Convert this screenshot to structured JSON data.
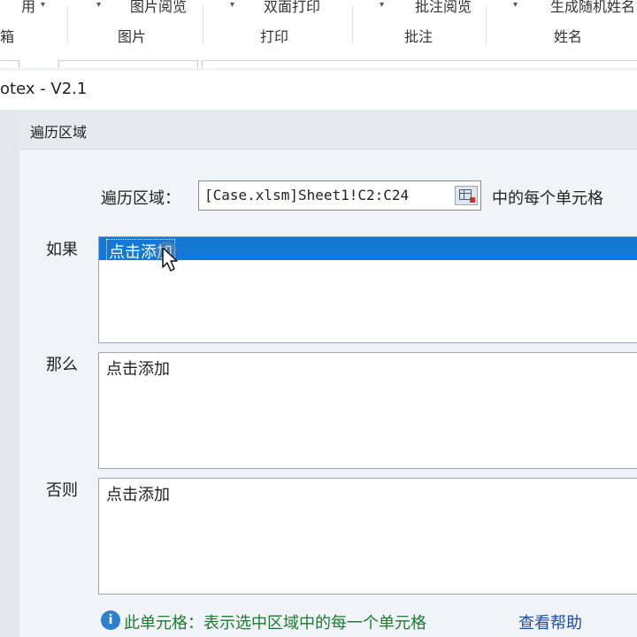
{
  "ribbon": {
    "groups": [
      {
        "button": "用",
        "label": "箱"
      },
      {
        "button": "图片阅览",
        "label": "图片"
      },
      {
        "button": "双面打印",
        "label": "打印"
      },
      {
        "button": "批注阅览",
        "label": "批注"
      },
      {
        "button": "生成随机姓名",
        "label": "姓名"
      }
    ]
  },
  "window": {
    "title": "otex - V2.1"
  },
  "section": {
    "title": "遍历区域"
  },
  "range": {
    "label": "遍历区域：",
    "value": "[Case.xlsm]Sheet1!C2:C24",
    "suffix": "中的每个单元格",
    "picker_icon": "range-select-icon"
  },
  "conditions": [
    {
      "label": "如果",
      "item": "点击添加",
      "selected": true
    },
    {
      "label": "那么",
      "item": "点击添加",
      "selected": false
    },
    {
      "label": "否则",
      "item": "点击添加",
      "selected": false
    }
  ],
  "footer": {
    "info_icon": "i",
    "text": "此单元格：表示选中区域中的每一个单元格",
    "help": "查看帮助"
  },
  "colors": {
    "selection": "#1378d6",
    "footer_text": "#1f7a2e",
    "link": "#1d4fa8"
  }
}
